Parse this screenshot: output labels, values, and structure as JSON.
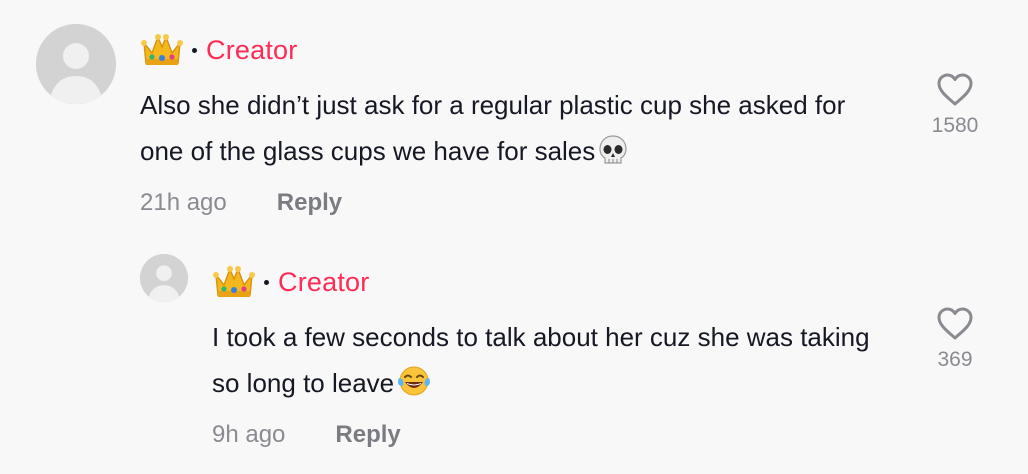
{
  "comments": [
    {
      "badge": "Creator",
      "text": "Also she didn’t just ask for a regular plastic cup she asked for one of the glass cups we have for sales",
      "emoji": "skull-icon",
      "time": "21h ago",
      "reply_label": "Reply",
      "likes": "1580"
    },
    {
      "badge": "Creator",
      "text": "I took a few seconds to talk about her cuz she was taking so long to leave",
      "emoji": "tears-of-joy-icon",
      "time": "9h ago",
      "reply_label": "Reply",
      "likes": "369"
    }
  ],
  "colors": {
    "accent": "#fe2c55",
    "text": "#161823",
    "muted": "#8a8b91",
    "background": "#f8f8f8",
    "avatar": "#d3d3d3"
  }
}
